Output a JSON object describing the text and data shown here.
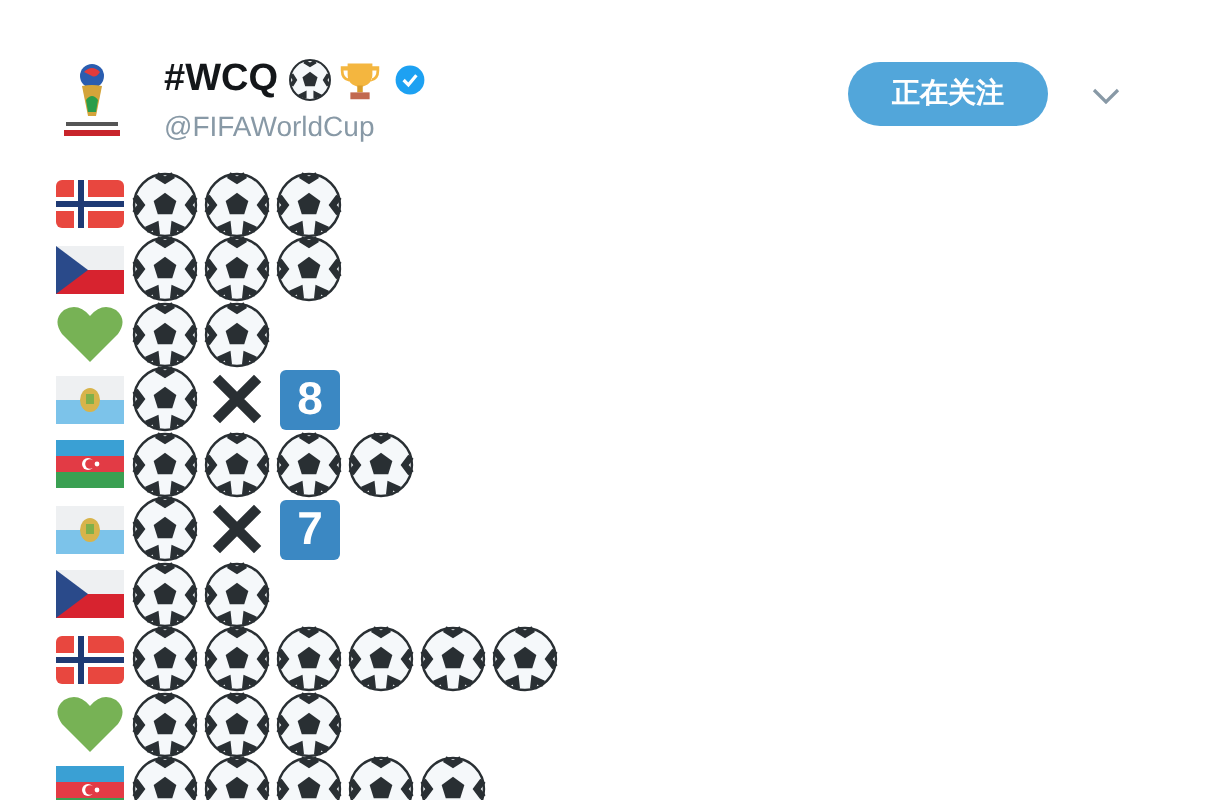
{
  "tweet": {
    "name": "#WCQ",
    "verified": true,
    "handle": "@FIFAWorldCup",
    "follow_button": "正在关注",
    "rows": [
      {
        "kind": "norway",
        "symbols": [
          {
            "kind": "ball"
          },
          {
            "kind": "ball"
          },
          {
            "kind": "ball"
          }
        ]
      },
      {
        "kind": "czech",
        "symbols": [
          {
            "kind": "ball"
          },
          {
            "kind": "ball"
          },
          {
            "kind": "ball"
          }
        ]
      },
      {
        "kind": "heart",
        "symbols": [
          {
            "kind": "ball"
          },
          {
            "kind": "ball"
          }
        ]
      },
      {
        "kind": "sanmarino",
        "symbols": [
          {
            "kind": "ball"
          },
          {
            "kind": "cross"
          },
          {
            "kind": "keycap",
            "text": "8"
          }
        ]
      },
      {
        "kind": "azerbaijan",
        "symbols": [
          {
            "kind": "ball"
          },
          {
            "kind": "ball"
          },
          {
            "kind": "ball"
          },
          {
            "kind": "ball"
          }
        ]
      },
      {
        "kind": "sanmarino",
        "symbols": [
          {
            "kind": "ball"
          },
          {
            "kind": "cross"
          },
          {
            "kind": "keycap",
            "text": "7"
          }
        ]
      },
      {
        "kind": "czech",
        "symbols": [
          {
            "kind": "ball"
          },
          {
            "kind": "ball"
          }
        ]
      },
      {
        "kind": "norway",
        "symbols": [
          {
            "kind": "ball"
          },
          {
            "kind": "ball"
          },
          {
            "kind": "ball"
          },
          {
            "kind": "ball"
          },
          {
            "kind": "ball"
          },
          {
            "kind": "ball"
          }
        ]
      },
      {
        "kind": "heart",
        "symbols": [
          {
            "kind": "ball"
          },
          {
            "kind": "ball"
          },
          {
            "kind": "ball"
          }
        ]
      },
      {
        "kind": "azerbaijan",
        "symbols": [
          {
            "kind": "ball"
          },
          {
            "kind": "ball"
          },
          {
            "kind": "ball"
          },
          {
            "kind": "ball"
          },
          {
            "kind": "ball"
          }
        ]
      }
    ]
  }
}
